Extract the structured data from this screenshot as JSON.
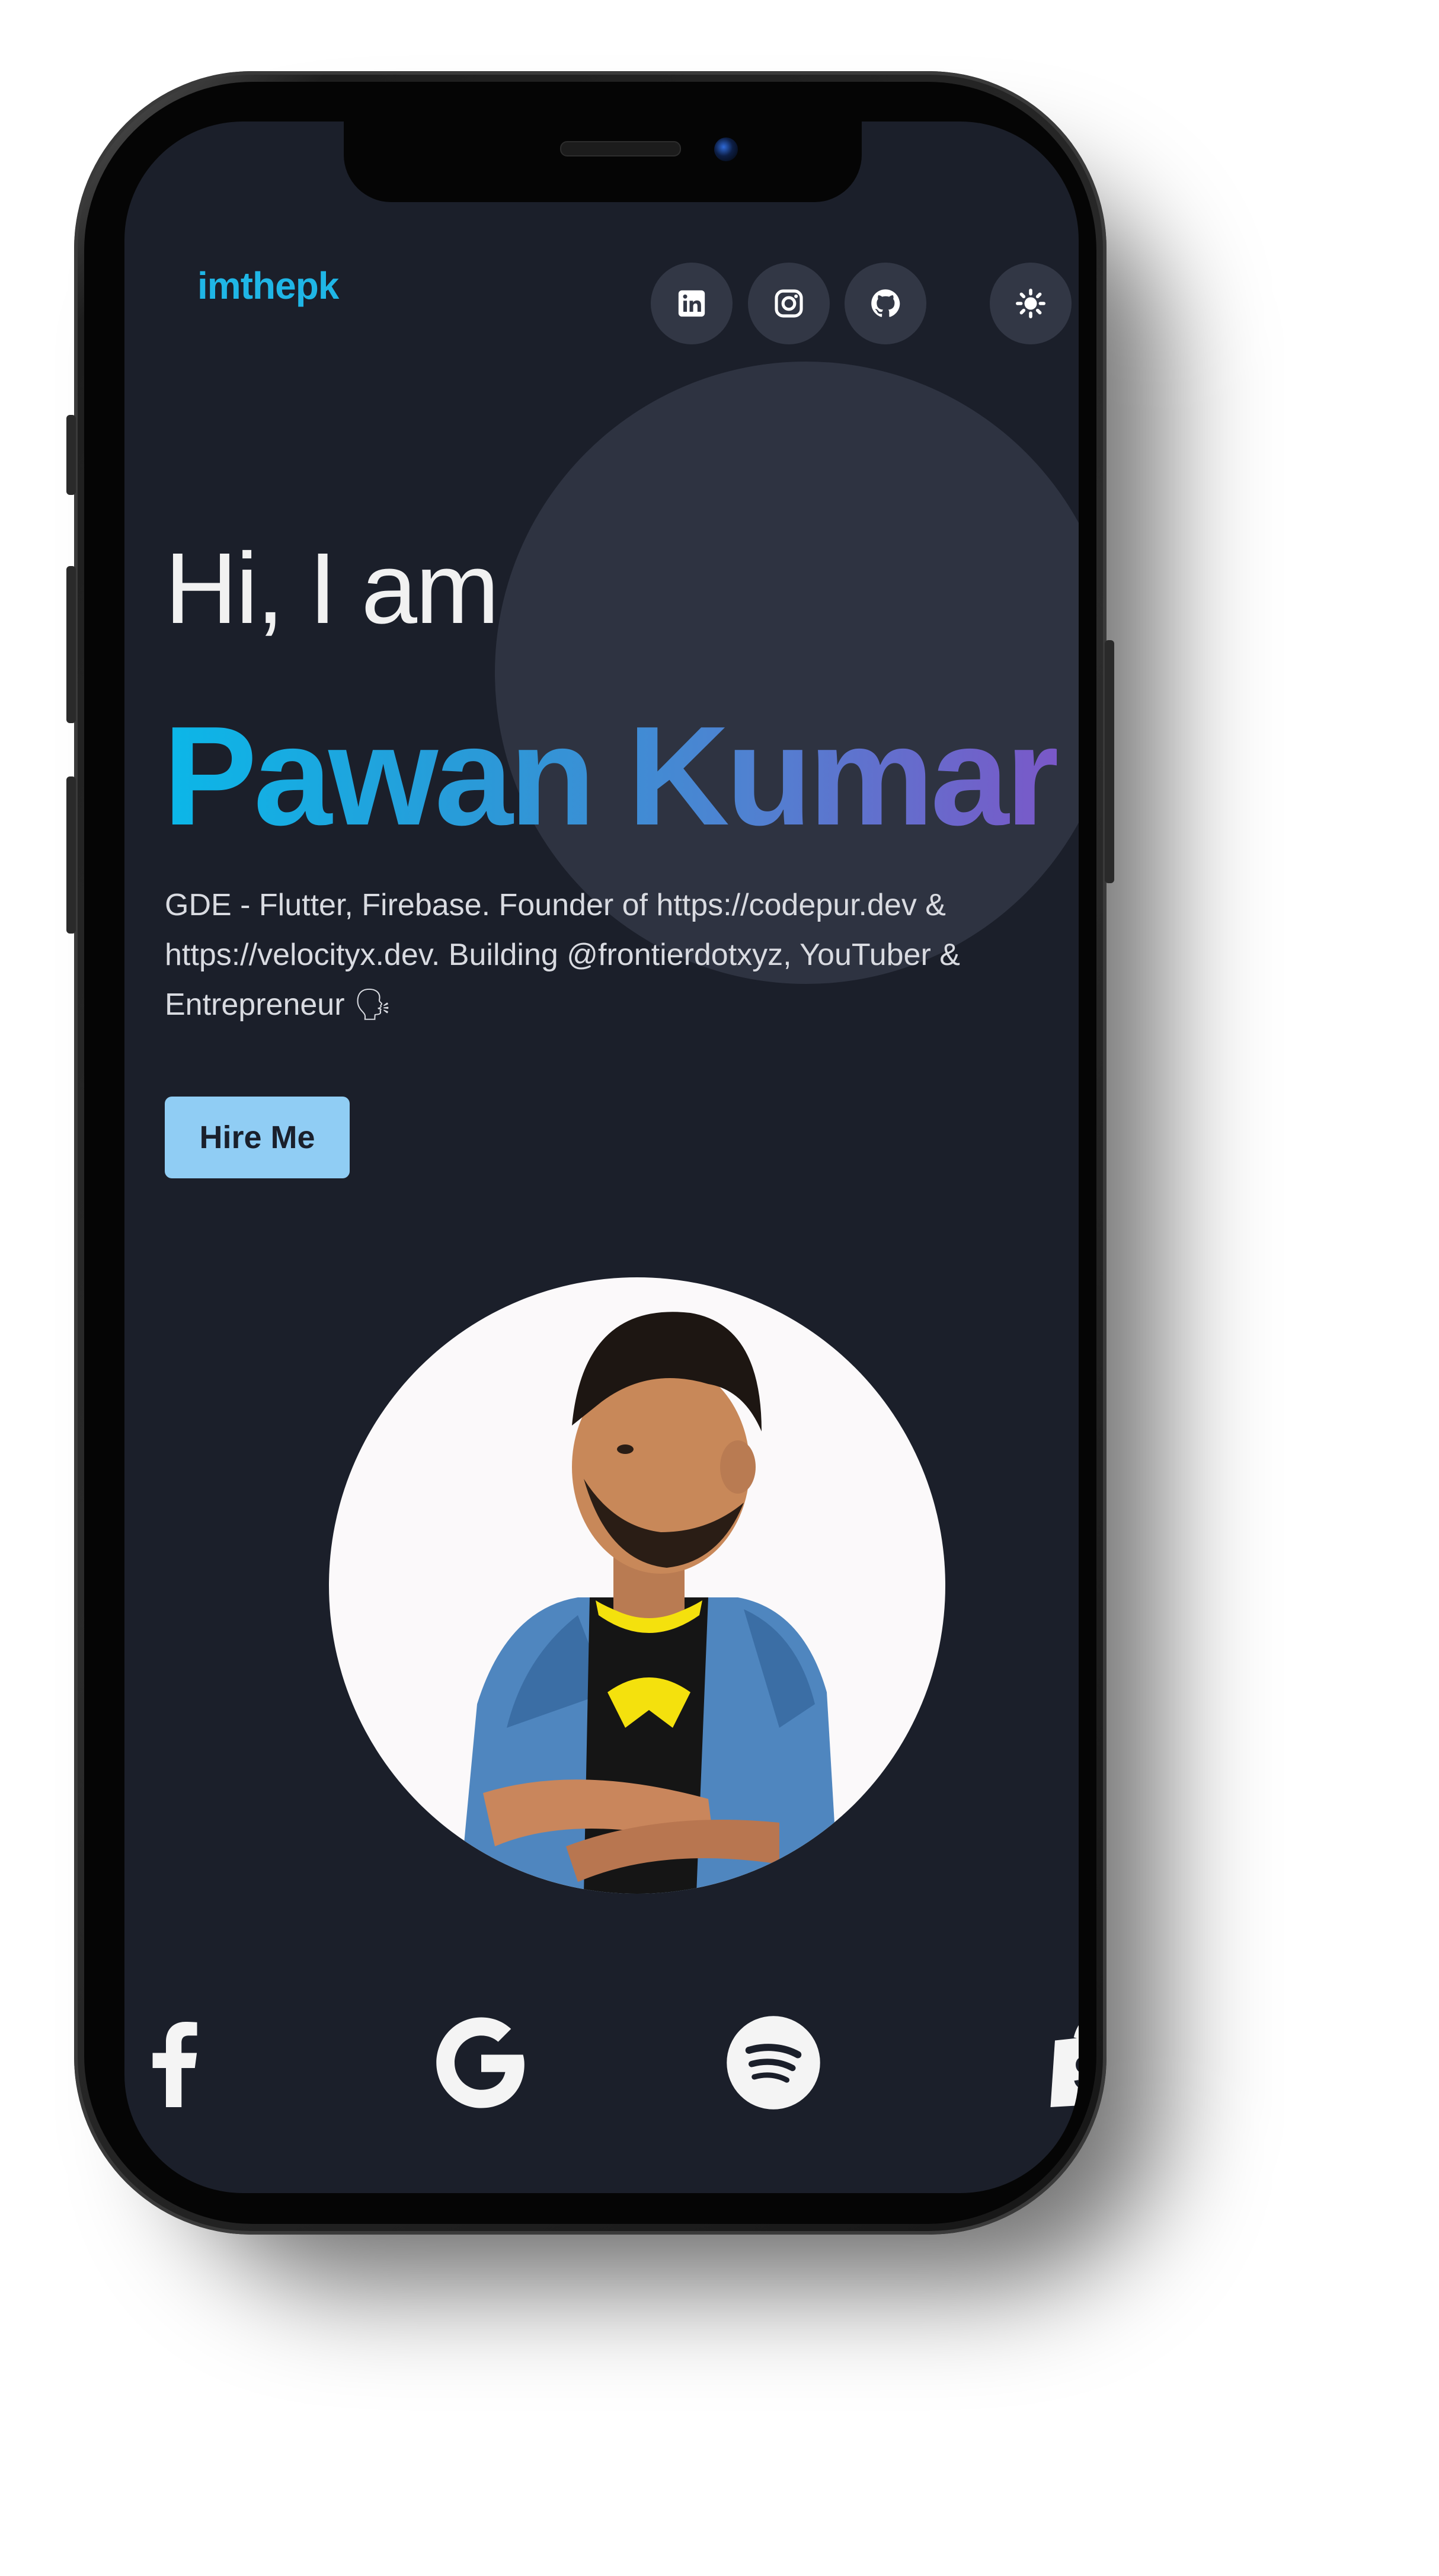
{
  "header": {
    "brand": "imthepk",
    "social_icons": [
      "linkedin-icon",
      "instagram-icon",
      "github-icon"
    ],
    "theme_toggle_icon": "sun-icon"
  },
  "hero": {
    "greeting": "Hi, I am",
    "name": "Pawan Kumar",
    "bio_lines": [
      "GDE - Flutter, Firebase. Founder of https://codepur.dev &",
      "https://velocityx.dev. Building @frontierdotxyz, YouTuber &",
      "Entrepreneur 🗣"
    ],
    "cta_label": "Hire Me",
    "avatar": "profile-photo"
  },
  "brands": [
    "facebook-icon",
    "google-icon",
    "spotify-icon",
    "shopify-icon"
  ],
  "colors": {
    "screen_bg": "#1b1f2a",
    "brand": "#1fb6e6",
    "button_bg": "#90cdf4",
    "name_gradient": [
      "#0bb7e8",
      "#7a58c8"
    ]
  }
}
